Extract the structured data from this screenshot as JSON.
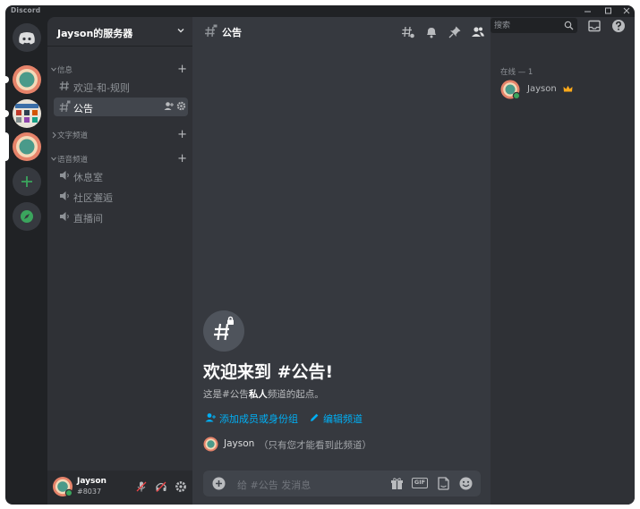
{
  "window": {
    "app_title": "Discord"
  },
  "rail": {
    "servers": [
      {
        "id": "home",
        "icon": "discord-logo-icon",
        "color": "#36393f"
      },
      {
        "id": "server-1",
        "icon": "avatar-ring"
      },
      {
        "id": "server-2",
        "icon": "game-thumbnail"
      },
      {
        "id": "server-3",
        "icon": "avatar-ring"
      },
      {
        "id": "add",
        "icon": "plus-icon",
        "color": "#3ba55d"
      },
      {
        "id": "explore",
        "icon": "compass-icon",
        "color": "#3ba55d"
      }
    ]
  },
  "sidebar": {
    "guild_name": "Jayson的服务器",
    "categories": [
      {
        "label": "信息",
        "channels": [
          {
            "label": "欢迎-和-规则",
            "type": "text"
          },
          {
            "label": "公告",
            "type": "announcement",
            "active": true
          }
        ]
      },
      {
        "label": "文字频道",
        "channels": []
      },
      {
        "label": "语音频道",
        "channels": [
          {
            "label": "休息室",
            "type": "voice"
          },
          {
            "label": "社区邂逅",
            "type": "voice"
          },
          {
            "label": "直播间",
            "type": "voice"
          }
        ]
      }
    ],
    "category_plus": "+"
  },
  "user_panel": {
    "username": "Jayson",
    "tag": "#8037"
  },
  "main": {
    "channel_title": "公告",
    "search_placeholder": "搜索",
    "welcome": {
      "title": "欢迎来到 #公告!",
      "subtitle_pre": "这是#公告",
      "subtitle_bold": "私人",
      "subtitle_post": "频道的起点。",
      "link_add": "添加成员或身份组",
      "link_edit": "编辑频道",
      "note_name": "Jayson",
      "note_text": "（只有您才能看到此频道）"
    },
    "composer_placeholder": "给 #公告 发消息",
    "gif_label": "GIF"
  },
  "members": {
    "header": "在线 — 1",
    "list": [
      {
        "name": "Jayson",
        "owner": true
      }
    ]
  },
  "colors": {
    "rail": "#202225",
    "sidebar": "#2f3136",
    "main": "#36393f",
    "link": "#00aff4",
    "online": "#3ba55d",
    "crown": "#faa81a"
  }
}
